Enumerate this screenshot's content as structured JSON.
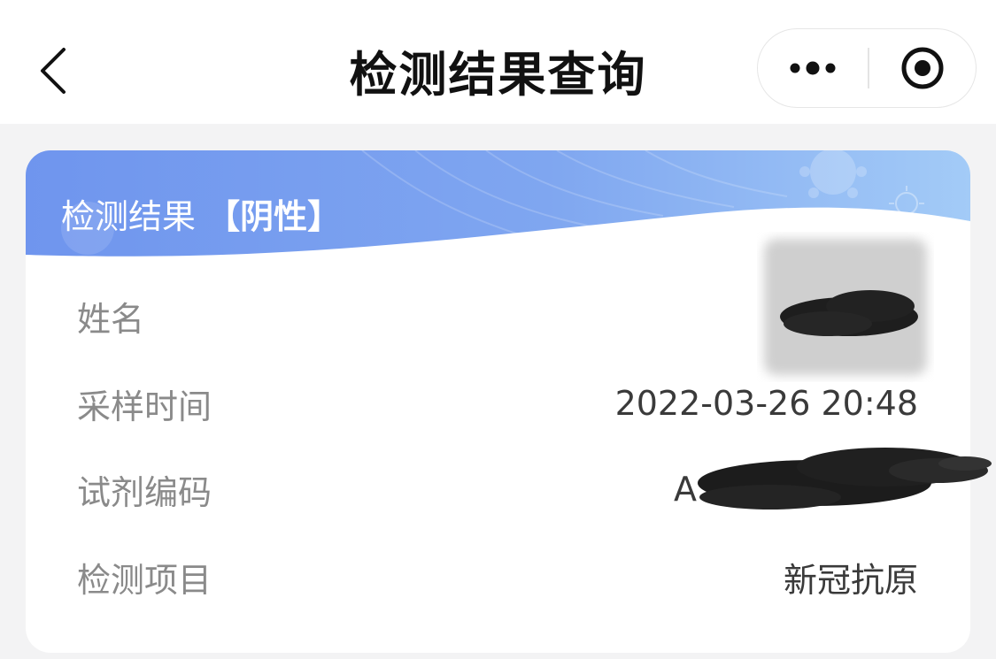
{
  "nav": {
    "title": "检测结果查询",
    "back_icon": "chevron-left-icon",
    "more_icon": "more-dots-icon",
    "close_icon": "target-circle-icon"
  },
  "card": {
    "header_prefix": "检测结果",
    "header_result": "【阴性】",
    "accent_gradient_start": "#6f95ee",
    "accent_gradient_end": "#9bc4f7",
    "rows": [
      {
        "label": "姓名",
        "value": ""
      },
      {
        "label": "采样时间",
        "value": "2022-03-26 20:48"
      },
      {
        "label": "试剂编码",
        "value": "A"
      },
      {
        "label": "检测项目",
        "value": "新冠抗原"
      }
    ]
  }
}
